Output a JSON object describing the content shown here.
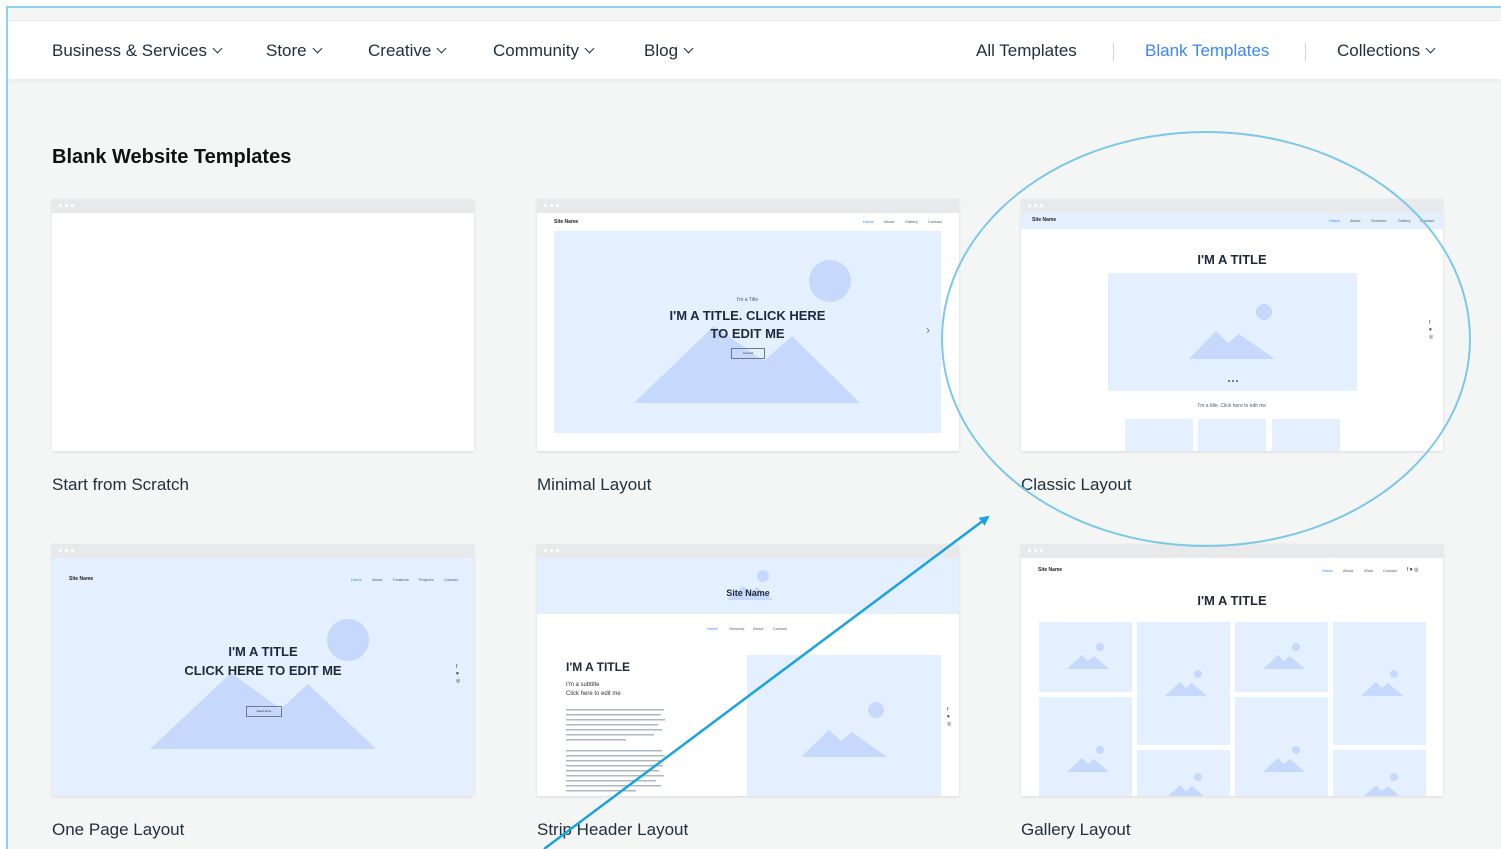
{
  "nav": {
    "left": [
      {
        "label": "Business & Services"
      },
      {
        "label": "Store"
      },
      {
        "label": "Creative"
      },
      {
        "label": "Community"
      },
      {
        "label": "Blog"
      }
    ],
    "all_templates": "All Templates",
    "blank_templates": "Blank Templates",
    "collections": "Collections"
  },
  "section_title": "Blank Website Templates",
  "templates": [
    {
      "label": "Start from Scratch"
    },
    {
      "label": "Minimal Layout",
      "preview": {
        "site_name": "Site Name",
        "menu": [
          "Home",
          "About",
          "Gallery",
          "Contact"
        ],
        "kicker": "I'm a Title",
        "headline_1": "I'M A TITLE. CLICK HERE",
        "headline_2": "TO EDIT ME",
        "button": "Contact"
      }
    },
    {
      "label": "Classic Layout",
      "preview": {
        "site_name": "Site Name",
        "menu": [
          "Home",
          "About",
          "Services",
          "Gallery",
          "Contact"
        ],
        "title": "I'M A TITLE",
        "caption": "I'm a title. Click here to edit me"
      }
    },
    {
      "label": "One Page Layout",
      "preview": {
        "site_name": "Site Name",
        "menu": [
          "Home",
          "About",
          "Features",
          "Projects",
          "Contact"
        ],
        "headline_1": "I'M A TITLE",
        "headline_2": "CLICK HERE TO EDIT ME",
        "button": "Read More"
      }
    },
    {
      "label": "Strip Header Layout",
      "preview": {
        "site_name": "Site Name",
        "menu": [
          "Home",
          "Services",
          "About",
          "Contact"
        ],
        "title": "I'M A TITLE",
        "subtitle_1": "I'm a subtitle",
        "subtitle_2": "Click here to edit me"
      }
    },
    {
      "label": "Gallery Layout",
      "preview": {
        "site_name": "Site Name",
        "menu": [
          "Home",
          "About",
          "Work",
          "Contact"
        ],
        "title": "I'M A TITLE"
      }
    }
  ],
  "colors": {
    "accent": "#3a86ff",
    "highlight": "#7cc8e8",
    "placeholder": "#e4efff"
  }
}
